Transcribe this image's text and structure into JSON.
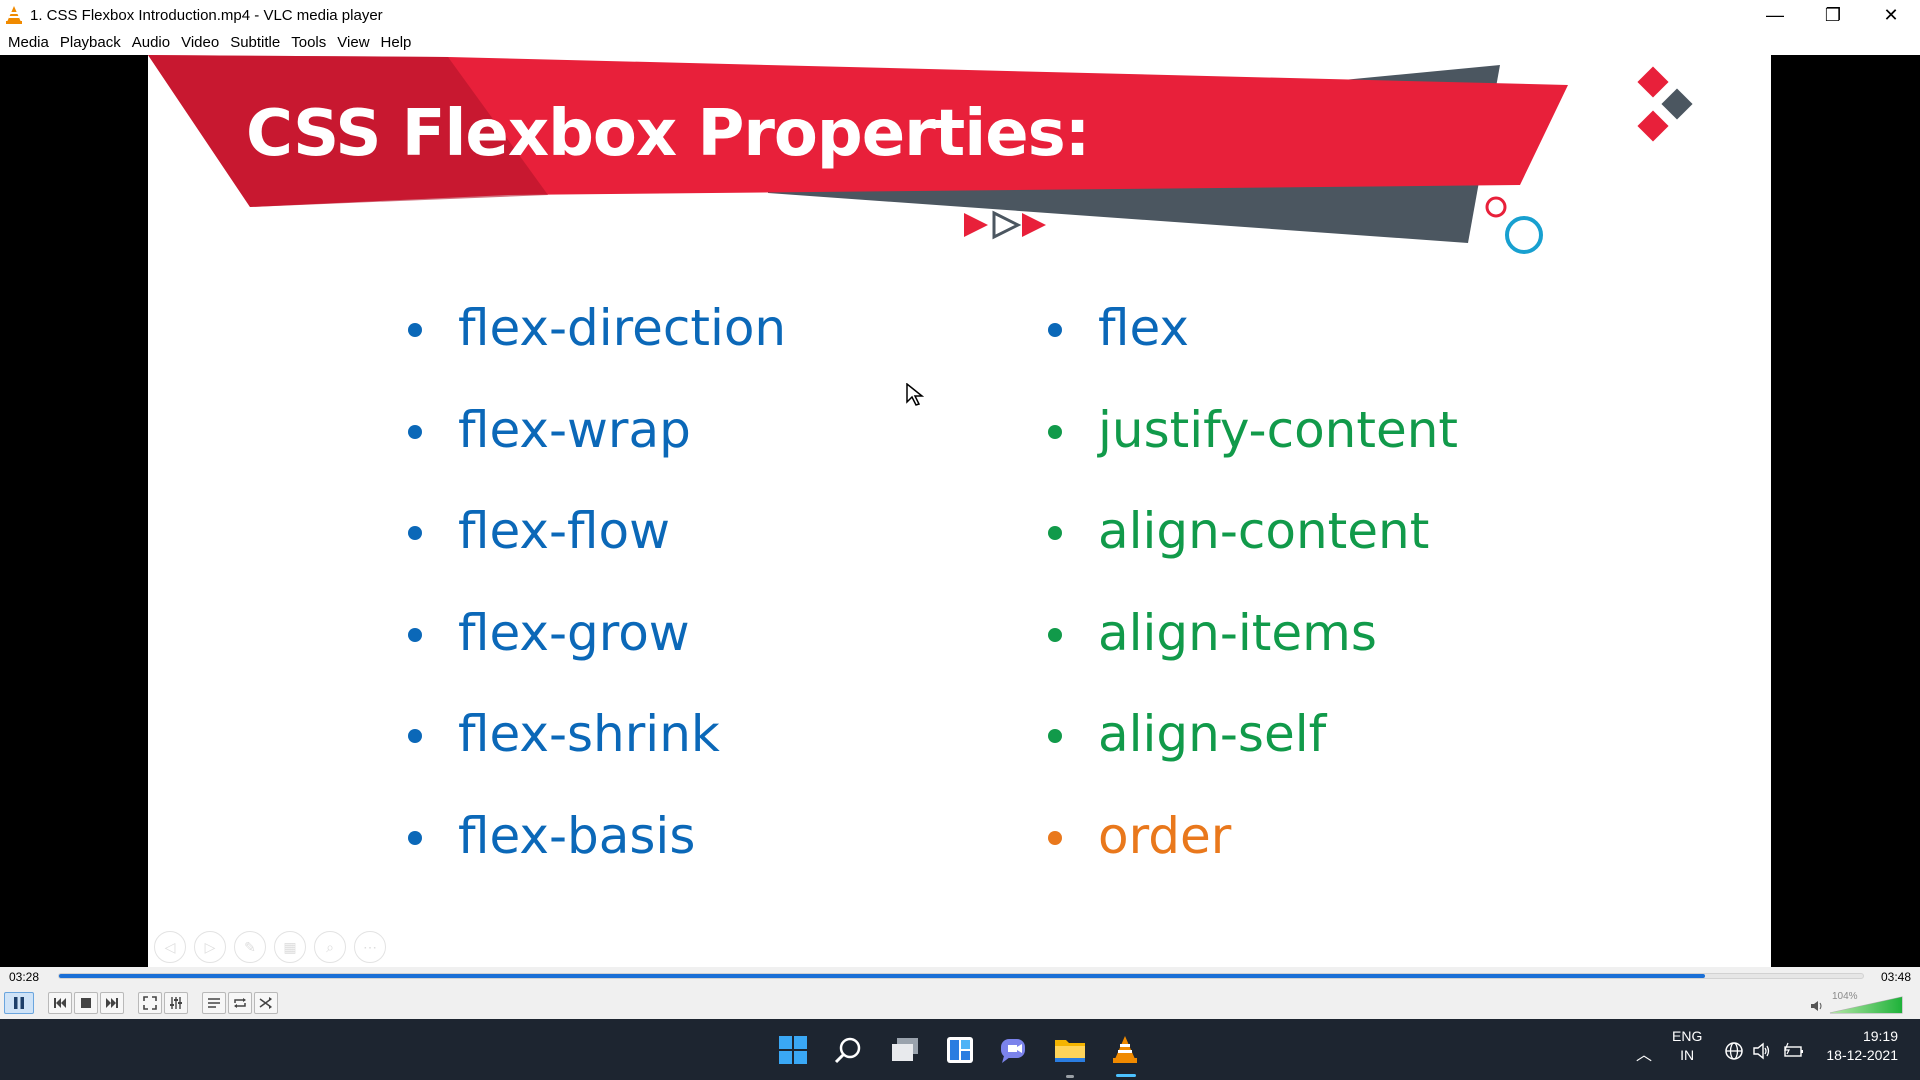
{
  "window": {
    "title": "1. CSS Flexbox Introduction.mp4 - VLC media player",
    "minimize": "—",
    "restore": "❐",
    "close": "✕"
  },
  "menu": [
    "Media",
    "Playback",
    "Audio",
    "Video",
    "Subtitle",
    "Tools",
    "View",
    "Help"
  ],
  "slide": {
    "title": "CSS Flexbox Properties:",
    "left_items": [
      {
        "text": "flex-direction",
        "color": "#0b68b8"
      },
      {
        "text": "flex-wrap",
        "color": "#0b68b8"
      },
      {
        "text": "flex-flow",
        "color": "#0b68b8"
      },
      {
        "text": "flex-grow",
        "color": "#0b68b8"
      },
      {
        "text": "flex-shrink",
        "color": "#0b68b8"
      },
      {
        "text": "flex-basis",
        "color": "#0b68b8"
      }
    ],
    "right_items": [
      {
        "text": "flex",
        "color": "#0b68b8"
      },
      {
        "text": "justify-content",
        "color": "#119a4a"
      },
      {
        "text": "align-content",
        "color": "#119a4a"
      },
      {
        "text": "align-items",
        "color": "#119a4a"
      },
      {
        "text": "align-self",
        "color": "#119a4a"
      },
      {
        "text": "order",
        "color": "#e9781c"
      }
    ]
  },
  "player": {
    "time_current": "03:28",
    "time_total": "03:48",
    "progress": 0.9123,
    "volume_label": "104%",
    "volume_level": 1.04
  },
  "taskbar": {
    "lang_top": "ENG",
    "lang_bottom": "IN",
    "time": "19:19",
    "date": "18-12-2021"
  },
  "colors": {
    "banner_red": "#e8203a",
    "banner_gray": "#4b5660",
    "accent_cyan": "#18a0d0",
    "vlc_orange": "#f08a00",
    "seek_blue": "#1a6fd6"
  }
}
